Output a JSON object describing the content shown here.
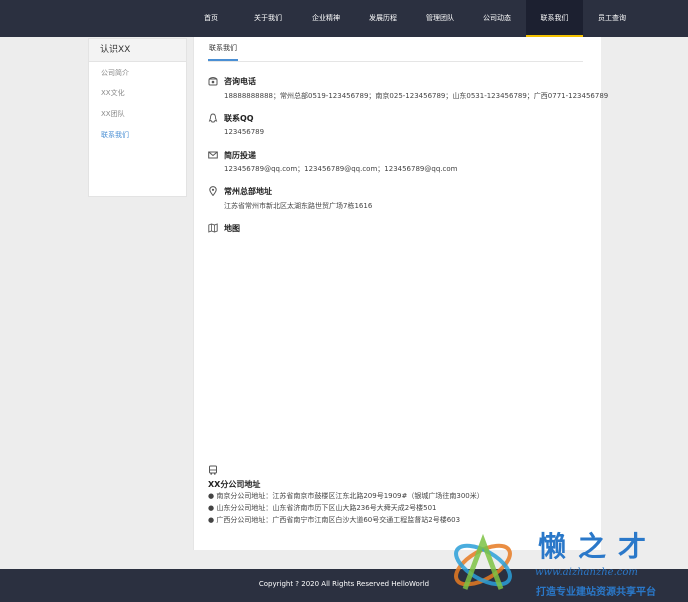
{
  "nav": {
    "items": [
      "首页",
      "关于我们",
      "企业精神",
      "发展历程",
      "管理团队",
      "公司动态",
      "联系我们",
      "员工查询"
    ],
    "active_index": 6
  },
  "sidebar": {
    "title": "认识XX",
    "items": [
      "公司简介",
      "XX文化",
      "XX团队",
      "联系我们"
    ],
    "active_index": 3
  },
  "content": {
    "tab": "联系我们",
    "sections": [
      {
        "icon": "phone-icon",
        "title": "咨询电话",
        "text": "18888888888；常州总部0519-123456789；南京025-123456789；山东0531-123456789；广西0771-123456789"
      },
      {
        "icon": "qq-icon",
        "title": "联系QQ",
        "text": "123456789"
      },
      {
        "icon": "mail-icon",
        "title": "简历投递",
        "text": "123456789@qq.com；123456789@qq.com；123456789@qq.com"
      },
      {
        "icon": "location-icon",
        "title": "常州总部地址",
        "text": "江苏省常州市新北区太湖东路世贸广场7栋1616"
      },
      {
        "icon": "map-icon",
        "title": "地图",
        "text": ""
      }
    ],
    "branch": {
      "icon": "bus-icon",
      "title": "XX分公司地址",
      "items": [
        "● 南京分公司地址：江苏省南京市鼓楼区江东北路209号1909#（银城广场往南300米）",
        "● 山东分公司地址：山东省济南市历下区山大路236号大舜天成2号楼501",
        "● 广西分公司地址：广西省南宁市江南区白沙大道60号交通工程监督站2号楼603"
      ]
    }
  },
  "footer": {
    "copyright": "Copyright ? 2020 All Rights Reserved HelloWorld"
  },
  "watermark": {
    "title": "懒之才",
    "url": "www.aizhanzhe.com",
    "subtitle": "打造专业建站资源共享平台"
  },
  "colors": {
    "header_bg": "#2b3040",
    "accent": "#f3c100",
    "link": "#4a8fd4",
    "watermark": "#2a78c9"
  }
}
